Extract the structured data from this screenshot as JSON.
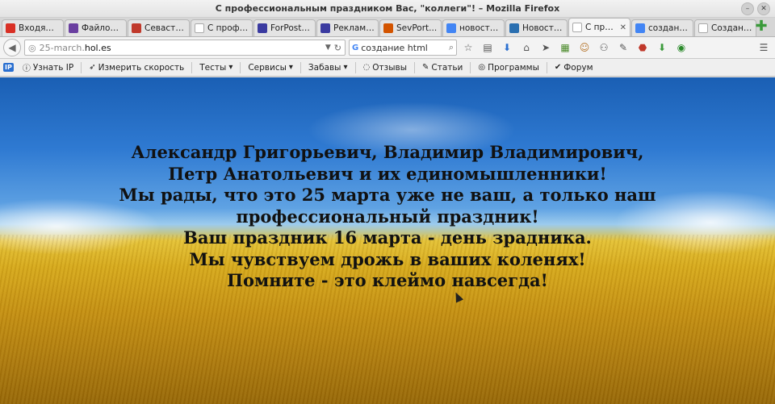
{
  "window": {
    "title": "С профессиональным праздником Вас, \"коллеги\"! – Mozilla Firefox"
  },
  "tabs": [
    {
      "label": "Входящ...",
      "icon": "mail-icon",
      "color": "#d93025"
    },
    {
      "label": "Файлов...",
      "icon": "castle-icon",
      "color": "#6a3fa0"
    },
    {
      "label": "Севасто...",
      "icon": "sevastopol-icon",
      "color": "#c0392b"
    },
    {
      "label": "С професс...",
      "icon": "blank-page-icon",
      "color": "#ffffff"
    },
    {
      "label": "ForPost ...",
      "icon": "forpost-icon",
      "color": "#3a3aa0"
    },
    {
      "label": "Реклама...",
      "icon": "forpost-icon",
      "color": "#3a3aa0"
    },
    {
      "label": "SevPort...",
      "icon": "sevport-icon",
      "color": "#d35400"
    },
    {
      "label": "новости...",
      "icon": "google-icon",
      "color": "#4285f4"
    },
    {
      "label": "Новости...",
      "icon": "news-icon",
      "color": "#2a6fb0"
    },
    {
      "label": "С профе...",
      "icon": "blank-page-icon",
      "color": "#ffffff",
      "active": true
    },
    {
      "label": "создани...",
      "icon": "google-icon",
      "color": "#4285f4"
    },
    {
      "label": "Создание п...",
      "icon": "blank-page-icon",
      "color": "#ffffff"
    }
  ],
  "nav": {
    "url_prefix": "25-march.",
    "url_host": "hol.es",
    "search_value": "создание html"
  },
  "bookmarks": [
    {
      "label": "Узнать IP",
      "icon": "info-icon"
    },
    {
      "label": "Измерить скорость",
      "icon": "speed-icon"
    },
    {
      "label": "Тесты",
      "icon": "",
      "dropdown": true
    },
    {
      "label": "Сервисы",
      "icon": "",
      "dropdown": true
    },
    {
      "label": "Забавы",
      "icon": "",
      "dropdown": true
    },
    {
      "label": "Отзывы",
      "icon": "comment-icon"
    },
    {
      "label": "Статьи",
      "icon": "pencil-icon"
    },
    {
      "label": "Программы",
      "icon": "disc-icon"
    },
    {
      "label": "Форум",
      "icon": "check-icon"
    }
  ],
  "bookmarks_badge": "IP",
  "message": {
    "lines": [
      "Александр Григорьевич, Владимир Владимирович,",
      "Петр Анатольевич и их единомышленники!",
      "Мы рады, что это 25 марта уже не ваш, а только наш",
      "профессиональный праздник!",
      "Ваш праздник 16 марта - день зрадника.",
      "Мы чувствуем дрожь в ваших коленях!",
      "Помните - это клеймо навсегда!"
    ]
  },
  "colors": {
    "sky": "#2f7ad2",
    "wheat": "#d6a91c"
  }
}
